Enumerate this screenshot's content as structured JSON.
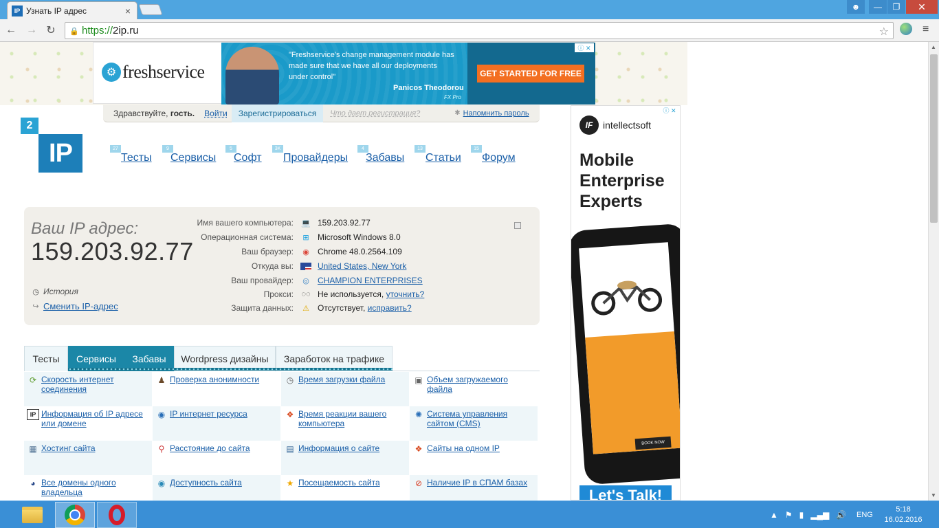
{
  "browser": {
    "tab_title": "Узнать IP адрес",
    "tab_favicon": "IP",
    "url_scheme": "https://",
    "url_host": "2ip.ru",
    "icons": [
      "user-icon",
      "minimize-icon",
      "maximize-icon",
      "close-icon",
      "back-icon",
      "forward-icon",
      "reload-icon",
      "lock-icon",
      "star-icon",
      "globe-extension-icon",
      "menu-icon"
    ]
  },
  "top_ad": {
    "brand": "freshservice",
    "quote": "\"Freshservice's change management module has made sure that we have all our deployments under control\"",
    "author": "Panicos Theodorou",
    "author_company": "FX Pro",
    "cta": "GET STARTED FOR FREE",
    "colors": {
      "panel": "#1a9ac9",
      "cta": "#f36f21"
    }
  },
  "login": {
    "greeting": "Здравствуйте, ",
    "guest": "гость.",
    "login_link": "Войти",
    "register": "Зарегистрироваться",
    "what_gives": "Что дает регистрация?",
    "remind": "Напомнить пароль"
  },
  "logo": {
    "top": "2",
    "main": "IP"
  },
  "nav": [
    {
      "label": "Тесты",
      "badge": "27"
    },
    {
      "label": "Сервисы",
      "badge": "9"
    },
    {
      "label": "Софт",
      "badge": "5"
    },
    {
      "label": "Провайдеры",
      "badge": "3K"
    },
    {
      "label": "Забавы",
      "badge": "4"
    },
    {
      "label": "Статьи",
      "badge": "13"
    },
    {
      "label": "Форум",
      "badge": "15"
    }
  ],
  "ip": {
    "label": "Ваш IP адрес:",
    "value": "159.203.92.77",
    "history": "История",
    "change": "Сменить IP-адрес"
  },
  "info": [
    {
      "key": "Имя вашего компьютера:",
      "icon": "computer-icon",
      "value": "159.203.92.77",
      "link": ""
    },
    {
      "key": "Операционная система:",
      "icon": "windows-icon",
      "value": "Microsoft Windows 8.0",
      "link": ""
    },
    {
      "key": "Ваш браузер:",
      "icon": "chrome-icon",
      "value": "Chrome 48.0.2564.109",
      "link": ""
    },
    {
      "key": "Откуда вы:",
      "icon": "us-flag-icon",
      "value": "",
      "link": "United States, New York"
    },
    {
      "key": "Ваш провайдер:",
      "icon": "provider-icon",
      "value": "",
      "link": "CHAMPION ENTERPRISES"
    },
    {
      "key": "Прокси:",
      "icon": "glasses-icon",
      "value": "Не используется, ",
      "link": "уточнить?"
    },
    {
      "key": "Защита данных:",
      "icon": "warning-icon",
      "value": "Отсутствует, ",
      "link": "исправить?"
    }
  ],
  "tabs": [
    {
      "label": "Тесты",
      "active": false
    },
    {
      "label": "Сервисы",
      "active": true
    },
    {
      "label": "Забавы",
      "active": true
    },
    {
      "label": "Wordpress дизайны",
      "active": false
    },
    {
      "label": "Заработок на трафике",
      "active": false
    }
  ],
  "services": [
    [
      {
        "text": "Скорость интернет соединения",
        "icon": "speed-icon"
      },
      {
        "text": "Проверка анонимности",
        "icon": "spy-icon"
      },
      {
        "text": "Время загрузки файла",
        "icon": "clock-icon"
      },
      {
        "text": "Объем загружаемого файла",
        "icon": "file-size-icon"
      }
    ],
    [
      {
        "text": "Информация об IP адресе или домене",
        "icon": "ip-info-icon"
      },
      {
        "text": "IP интернет ресурса",
        "icon": "ip-resource-icon"
      },
      {
        "text": "Время реакции вашего компьютера",
        "icon": "reaction-icon"
      },
      {
        "text": "Система управления сайтом (CMS)",
        "icon": "cms-icon"
      }
    ],
    [
      {
        "text": "Хостинг сайта",
        "icon": "hosting-icon"
      },
      {
        "text": "Расстояние до сайта",
        "icon": "pin-icon"
      },
      {
        "text": "Информация о сайте",
        "icon": "site-info-icon"
      },
      {
        "text": "Сайты на одном IP",
        "icon": "sites-icon"
      }
    ],
    [
      {
        "text": "Все домены одного владельца",
        "icon": "owner-icon"
      },
      {
        "text": "Доступность сайта",
        "icon": "availability-icon"
      },
      {
        "text": "Посещаемость сайта",
        "icon": "star-icon"
      },
      {
        "text": "Наличие IP в СПАМ базах",
        "icon": "spam-icon"
      }
    ]
  ],
  "side_ad": {
    "brand": "intellectsoft",
    "mark": "IF",
    "headline": "Mobile Enterprise Experts",
    "cta": "Let's Talk!",
    "book_now": "BOOK NOW",
    "colors": {
      "cta": "#1f8ad6",
      "accent": "#f29b2a"
    }
  },
  "taskbar": {
    "apps": [
      "file-explorer-icon",
      "chrome-icon",
      "opera-icon"
    ],
    "lang": "ENG",
    "time": "5:18",
    "date": "16.02.2016"
  }
}
